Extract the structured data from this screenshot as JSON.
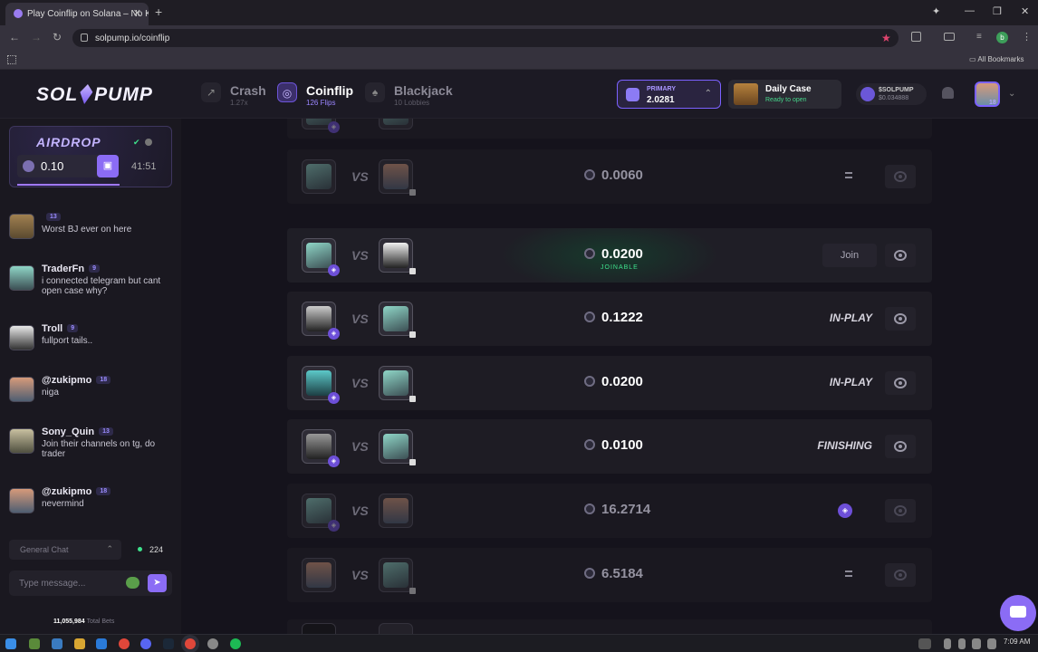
{
  "browser": {
    "tab_title": "Play Coinflip on Solana – No KYC",
    "url": "solpump.io/coinflip",
    "bookmarks_label": "All Bookmarks"
  },
  "header": {
    "logo_left": "SOL",
    "logo_right": "PUMP",
    "nav": [
      {
        "label": "Crash",
        "sub": "1.27x"
      },
      {
        "label": "Coinflip",
        "sub": "126 Flips"
      },
      {
        "label": "Blackjack",
        "sub": "10 Lobbies"
      }
    ],
    "wallet": {
      "label": "PRIMARY",
      "value": "2.0281"
    },
    "daily_case": {
      "title": "Daily Case",
      "sub": "Ready to open"
    },
    "token": {
      "name": "$SOLPUMP",
      "price": "$0.034888"
    },
    "user_level": "18"
  },
  "airdrop": {
    "title": "AIRDROP",
    "amount": "0.10",
    "timer": "41:51",
    "progress": 0.5
  },
  "chat": {
    "messages": [
      {
        "name": "",
        "level": "13",
        "text": "Worst BJ ever on here"
      },
      {
        "name": "TraderFn",
        "level": "9",
        "text": "i connected telegram but cant open case why?"
      },
      {
        "name": "Troll",
        "level": "9",
        "text": "fullport tails.."
      },
      {
        "name": "@zukipmo",
        "level": "18",
        "text": "niga"
      },
      {
        "name": "Sony_Quin",
        "level": "13",
        "text": "Join their channels on tg, do trader"
      },
      {
        "name": "@zukipmo",
        "level": "18",
        "text": "nevermind"
      }
    ],
    "channel": "General Chat",
    "online": "224",
    "placeholder": "Type message...",
    "total_bets": "11,055,984",
    "total_bets_label": "Total Bets"
  },
  "flips": [
    {
      "amount": "0.0060",
      "status": "",
      "state": "faded"
    },
    {
      "amount": "0.0200",
      "status": "",
      "sub": "JOINABLE",
      "join_label": "Join",
      "state": "joinable"
    },
    {
      "amount": "0.1222",
      "status": "IN-PLAY",
      "state": "active"
    },
    {
      "amount": "0.0200",
      "status": "IN-PLAY",
      "state": "active"
    },
    {
      "amount": "0.0100",
      "status": "FINISHING",
      "state": "active"
    },
    {
      "amount": "16.2714",
      "status": "",
      "state": "faded"
    },
    {
      "amount": "6.5184",
      "status": "",
      "state": "faded"
    }
  ],
  "vs_label": "VS",
  "taskbar": {
    "time": "7:09 AM"
  },
  "colors": {
    "accent": "#8b6cf5",
    "joinable": "#3ee28c",
    "background": "#15131c"
  }
}
